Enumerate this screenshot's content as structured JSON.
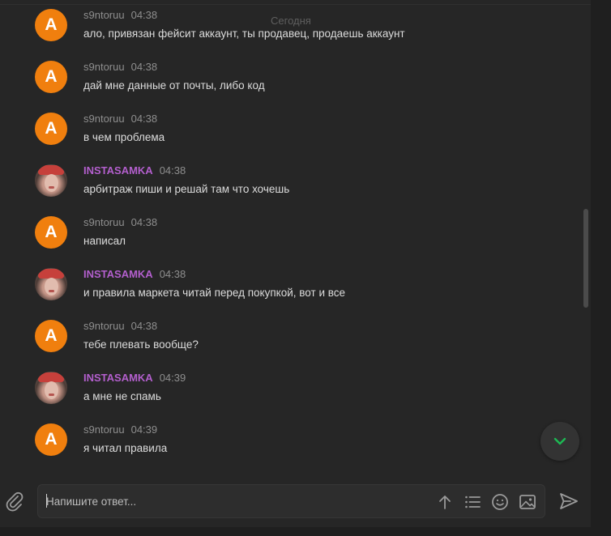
{
  "chat": {
    "date_separator": "Сегодня",
    "messages": [
      {
        "author": "s9ntoruu",
        "time": "04:38",
        "text": "ало, привязан фейсит аккаунт, ты продавец, продаешь аккаунт",
        "avatar_letter": "A"
      },
      {
        "author": "s9ntoruu",
        "time": "04:38",
        "text": "дай мне данные от почты, либо код",
        "avatar_letter": "A"
      },
      {
        "author": "s9ntoruu",
        "time": "04:38",
        "text": "в чем проблема",
        "avatar_letter": "A"
      },
      {
        "author": "INSTASAMKA",
        "time": "04:38",
        "text": "арбитраж пиши и решай там что хочешь"
      },
      {
        "author": "s9ntoruu",
        "time": "04:38",
        "text": "написал",
        "avatar_letter": "A"
      },
      {
        "author": "INSTASAMKA",
        "time": "04:38",
        "text": "и правила маркета читай перед покупкой, вот и все"
      },
      {
        "author": "s9ntoruu",
        "time": "04:38",
        "text": "тебе плевать вообще?",
        "avatar_letter": "A"
      },
      {
        "author": "INSTASAMKA",
        "time": "04:39",
        "text": "а мне не спамь"
      },
      {
        "author": "s9ntoruu",
        "time": "04:39",
        "text": "я читал правила",
        "avatar_letter": "A"
      }
    ]
  },
  "composer": {
    "placeholder": "Напишите ответ...",
    "value": ""
  },
  "colors": {
    "background": "#262626",
    "avatar_orange": "#f07f0e",
    "vip_author": "#b35fcd",
    "scroll_down_arrow": "#1db954"
  },
  "icons": {
    "attach": "paperclip-icon",
    "scroll_down": "chevron-down-icon",
    "upload": "arrow-up-icon",
    "list": "list-icon",
    "emoji": "smile-icon",
    "image": "image-icon",
    "send": "send-icon"
  }
}
